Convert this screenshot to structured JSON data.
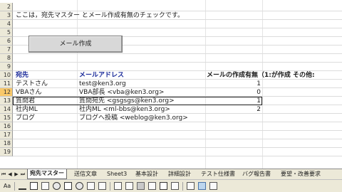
{
  "rows": [
    "2",
    "3",
    "4",
    "5",
    "6",
    "7",
    "8",
    "9",
    "10",
    "11",
    "12",
    "13",
    "14",
    "15",
    "16",
    "17",
    "18",
    "19"
  ],
  "selected_row": "12",
  "intro_text": "ここは，宛先マスター とメール作成有無のチェックです。",
  "create_mail_button": "メール作成",
  "table": {
    "headers": [
      "宛先",
      "メールアドレス",
      "メールの作成有無（1:が作成 その他:"
    ],
    "rows": [
      {
        "name": "テストさん",
        "email": "test@ken3.org",
        "flag": "1"
      },
      {
        "name": "VBAさん",
        "email": "VBA部長 <vba@ken3.org>",
        "flag": "0"
      },
      {
        "name": "質問君",
        "email": "質問宛先 <gsgsgs@ken3.org>",
        "flag": "1"
      },
      {
        "name": "社内ML",
        "email": "社内ML <ml-bbs@ken3.org>",
        "flag": "2"
      },
      {
        "name": "ブログ",
        "email": "ブログへ投稿 <weblog@ken3.org>",
        "flag": ""
      }
    ]
  },
  "sheet_tabs": [
    "宛先マスター",
    "送信文章",
    "Sheet3",
    "基本設計",
    "詳細設計",
    "テスト仕様書",
    "バグ報告書",
    "要望・改善要求"
  ],
  "active_tab": "宛先マスター",
  "toolbar_label": "Aa",
  "colors": {
    "text_blue": "#1b2b9a",
    "selected_header": "#f8c86a",
    "ui_gray": "#ece9d8"
  }
}
